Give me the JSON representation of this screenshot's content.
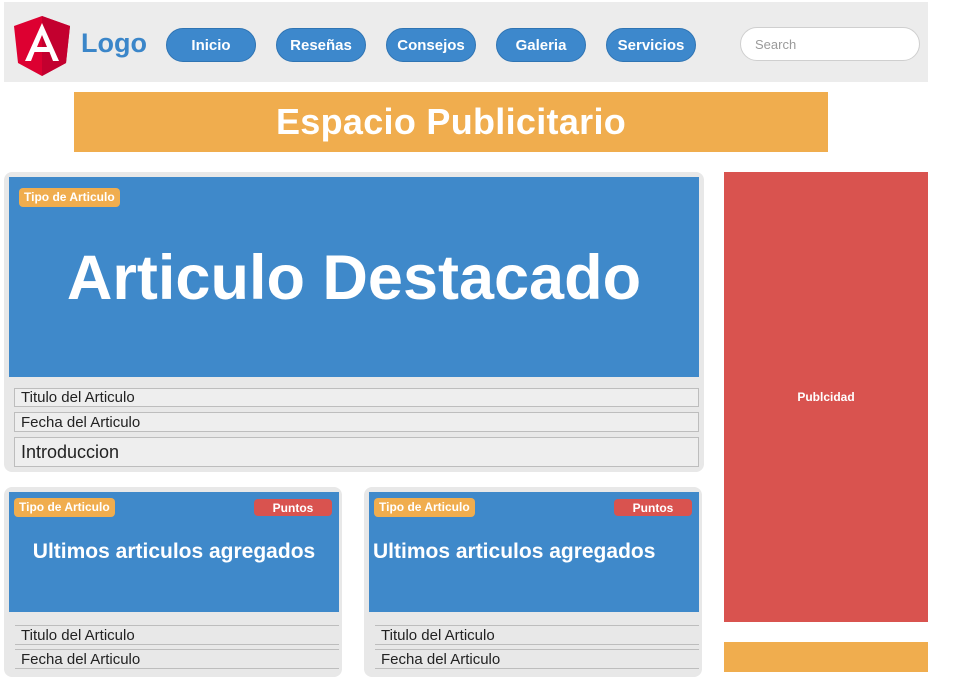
{
  "header": {
    "logo_text": "Logo",
    "nav": [
      "Inicio",
      "Reseñas",
      "Consejos",
      "Galeria",
      "Servicios"
    ],
    "search_placeholder": "Search"
  },
  "ad_banner": {
    "label": "Espacio Publicitario"
  },
  "featured": {
    "badge": "Tipo de Articulo",
    "title": "Articulo Destacado",
    "article_title": "Titulo del Articulo",
    "article_date": "Fecha del Articulo",
    "intro": "Introduccion"
  },
  "sidebar_ad": {
    "label": "Publcidad"
  },
  "latest": [
    {
      "badge": "Tipo de Articulo",
      "points": "Puntos",
      "title": "Ultimos articulos agregados",
      "article_title": "Titulo del Articulo",
      "article_date": "Fecha del Articulo"
    },
    {
      "badge": "Tipo de Articulo",
      "points": "Puntos",
      "title": "Ultimos articulos agregados",
      "article_title": "Titulo del Articulo",
      "article_date": "Fecha del Articulo"
    }
  ],
  "colors": {
    "brand_blue": "#3f89ca",
    "accent_orange": "#f0ad4e",
    "accent_red": "#d9534f",
    "logo_red": "#dd0031"
  }
}
